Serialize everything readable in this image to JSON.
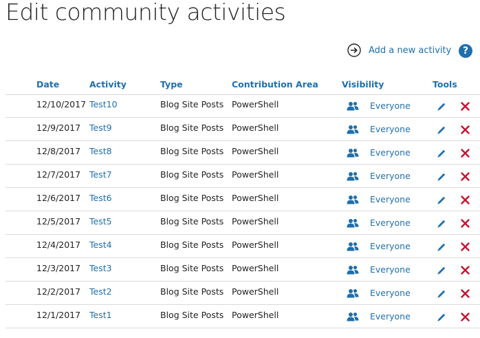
{
  "page": {
    "title": "Edit community activities"
  },
  "toolbar": {
    "add_label": "Add a new activity",
    "help_label": "?"
  },
  "colors": {
    "accent": "#1e6fae",
    "delete": "#c8102e",
    "divider": "#d9d9d9"
  },
  "table": {
    "headers": {
      "date": "Date",
      "activity": "Activity",
      "type": "Type",
      "area": "Contribution Area",
      "visibility": "Visibility",
      "tools": "Tools"
    },
    "rows": [
      {
        "date": "12/10/2017",
        "activity": "Test10",
        "type": "Blog Site Posts",
        "area": "PowerShell",
        "visibility": "Everyone"
      },
      {
        "date": "12/9/2017",
        "activity": "Test9",
        "type": "Blog Site Posts",
        "area": "PowerShell",
        "visibility": "Everyone"
      },
      {
        "date": "12/8/2017",
        "activity": "Test8",
        "type": "Blog Site Posts",
        "area": "PowerShell",
        "visibility": "Everyone"
      },
      {
        "date": "12/7/2017",
        "activity": "Test7",
        "type": "Blog Site Posts",
        "area": "PowerShell",
        "visibility": "Everyone"
      },
      {
        "date": "12/6/2017",
        "activity": "Test6",
        "type": "Blog Site Posts",
        "area": "PowerShell",
        "visibility": "Everyone"
      },
      {
        "date": "12/5/2017",
        "activity": "Test5",
        "type": "Blog Site Posts",
        "area": "PowerShell",
        "visibility": "Everyone"
      },
      {
        "date": "12/4/2017",
        "activity": "Test4",
        "type": "Blog Site Posts",
        "area": "PowerShell",
        "visibility": "Everyone"
      },
      {
        "date": "12/3/2017",
        "activity": "Test3",
        "type": "Blog Site Posts",
        "area": "PowerShell",
        "visibility": "Everyone"
      },
      {
        "date": "12/2/2017",
        "activity": "Test2",
        "type": "Blog Site Posts",
        "area": "PowerShell",
        "visibility": "Everyone"
      },
      {
        "date": "12/1/2017",
        "activity": "Test1",
        "type": "Blog Site Posts",
        "area": "PowerShell",
        "visibility": "Everyone"
      }
    ]
  }
}
